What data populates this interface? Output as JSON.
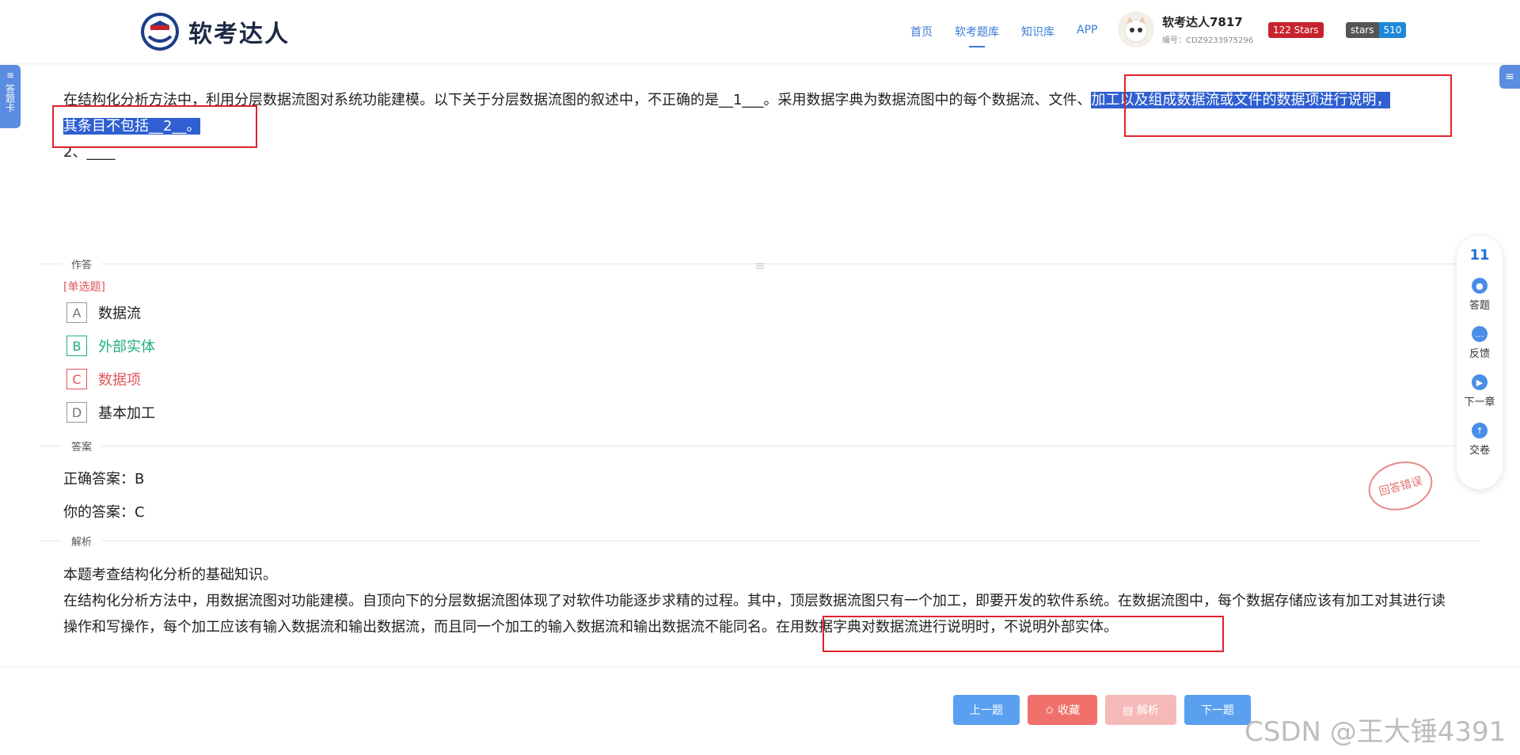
{
  "header": {
    "brand": "软考达人",
    "nav": [
      "首页",
      "软考题库",
      "知识库",
      "APP"
    ],
    "nav_active_index": 1,
    "user": {
      "name": "软考达人7817",
      "id": "编号：CDZ9233975296"
    },
    "badges": {
      "gitee": "122 Stars",
      "github_label": "stars",
      "github_count": "510"
    }
  },
  "side_tabs": {
    "left_label": "答题卡",
    "left_icon": "menu-icon",
    "right_icon": "menu-icon"
  },
  "question": {
    "text_before": "在结构化分析方法中，利用分层数据流图对系统功能建模。以下关于分层数据流图的叙述中，不正确的是__1___。采用数据字典为数据流图中的每个数据流、文件、",
    "text_highlight_1": "加工以及组成数据流或文件的数据项进行说明，",
    "text_highlight_2": "其条目不包括__2__。",
    "sub": "2、____"
  },
  "sections": {
    "answer_area": "作答",
    "answer": "答案",
    "analysis": "解析"
  },
  "options": {
    "type": "[单选题]",
    "items": [
      {
        "letter": "A",
        "text": "数据流",
        "state": "normal"
      },
      {
        "letter": "B",
        "text": "外部实体",
        "state": "correct"
      },
      {
        "letter": "C",
        "text": "数据项",
        "state": "wrong"
      },
      {
        "letter": "D",
        "text": "基本加工",
        "state": "normal"
      }
    ]
  },
  "answer": {
    "correct": "正确答案：B",
    "yours": "你的答案：C",
    "stamp": "回答错误"
  },
  "analysis": {
    "line1": "本题考查结构化分析的基础知识。",
    "para_before": "在结构化分析方法中，用数据流图对功能建模。自顶向下的分层数据流图体现了对软件功能逐步求精的过程。其中，顶层数据流图只有一个加工，即要开发的软件系统。在数据流图中，每个数据存储应该有加工对其进行读操作和写操作，每个加工应该有输入数据流和输出数据流，而且同一个加工的输入数据流和输出数据流不能同名。",
    "para_mark": "在用数据字典对数据流进行说明时，不说明外部实体。"
  },
  "float_panel": {
    "count": "11",
    "items": [
      {
        "label": "答题",
        "icon": "chat-icon"
      },
      {
        "label": "反馈",
        "icon": "feedback-icon"
      },
      {
        "label": "下一章",
        "icon": "skip-next-icon"
      },
      {
        "label": "交卷",
        "icon": "submit-icon"
      }
    ]
  },
  "buttons": {
    "prev": "上一题",
    "fav": "✩ 收藏",
    "analysis": "▤ 解析",
    "next": "下一题"
  },
  "watermark": "CSDN @王大锤4391",
  "colors": {
    "accent": "#3a7bd5",
    "highlight": "#2f5fd0",
    "correct": "#1fae7b",
    "wrong": "#e0555a",
    "annotation_box": "#e0222c"
  }
}
